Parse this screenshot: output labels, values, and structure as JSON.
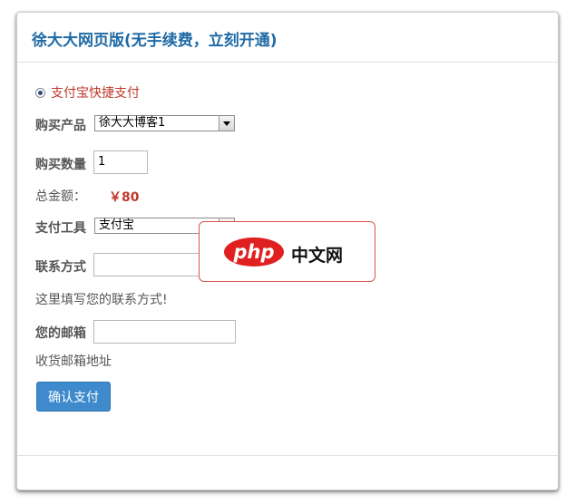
{
  "panel": {
    "title": "徐大大网页版(无手续费，立刻开通)"
  },
  "payment_option": {
    "label": "支付宝快捷支付",
    "selected": true
  },
  "product": {
    "label": "购买产品",
    "selected": "徐大大博客1"
  },
  "quantity": {
    "label": "购买数量",
    "value": "1"
  },
  "total": {
    "label": "总金额：",
    "value": "￥80"
  },
  "pay_tool": {
    "label": "支付工具",
    "selected": "支付宝"
  },
  "contact": {
    "label": "联系方式",
    "value": "",
    "hint": "这里填写您的联系方式!"
  },
  "email": {
    "label": "您的邮箱",
    "value": "",
    "hint": "收货邮箱地址"
  },
  "confirm_button": {
    "label": "确认支付"
  },
  "watermark": {
    "mark": "php",
    "text": "中文网"
  },
  "colors": {
    "title": "#1f6aa5",
    "accent_red": "#c0392b",
    "button": "#3e8acc"
  }
}
